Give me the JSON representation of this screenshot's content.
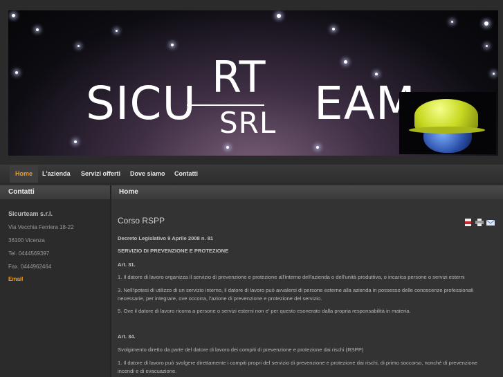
{
  "banner": {
    "logo_left": "SICU",
    "logo_top": "RT",
    "logo_bottom": "SRL",
    "logo_right": "EAM",
    "helmet_icon": "globe-helmet-icon"
  },
  "nav": {
    "items": [
      {
        "label": "Home",
        "active": true
      },
      {
        "label": "L'azienda",
        "active": false
      },
      {
        "label": "Servizi offerti",
        "active": false
      },
      {
        "label": "Dove siamo",
        "active": false
      },
      {
        "label": "Contatti",
        "active": false
      }
    ],
    "accent": "#f29a1e"
  },
  "sidebar": {
    "title": "Contatti",
    "company": "Sicurteam s.r.l.",
    "address": "Via Vecchia Ferriera 18-22",
    "city": "36100 Vicenza",
    "tel": "Tel. 0444569397",
    "fax": "Fax. 0444962464",
    "email": "Email"
  },
  "main": {
    "breadcrumb": "Home",
    "title": "Corso RSPP",
    "icons": [
      "pdf-icon",
      "print-icon",
      "email-icon"
    ],
    "paragraphs": [
      "Decreto Legislativo 9 Aprile 2008 n. 81",
      "SERVIZIO DI PREVENZIONE E PROTEZIONE",
      "Art. 31.",
      "1. Il datore di lavoro organizza il servizio di prevenzione e protezione all'interno dell'azienda o dell'unità produttiva, o incarica persone o servizi esterni",
      "3. Nell'ipotesi di utilizzo di un servizio interno, il datore di lavoro può avvalersi di persone esterne alla azienda in possesso delle conoscenze professionali necessarie, per integrare, ove occorra, l'azione di prevenzione e protezione del servizio.",
      "5. Ove il datore di lavoro ricorra a persone o servizi esterni non e' per questo esonerato dalla propria responsabilità in materia.",
      "Art. 34.",
      "Svolgimento diretto da parte del datore di lavoro dei compiti di prevenzione e protezione dai rischi  (RSPP)",
      "1. Il datore di lavoro può svolgere direttamente i compiti propri del servizio di prevenzione e protezione dai rischi, di primo soccorso, nonché di prevenzione incendi e di evacuazione."
    ]
  }
}
